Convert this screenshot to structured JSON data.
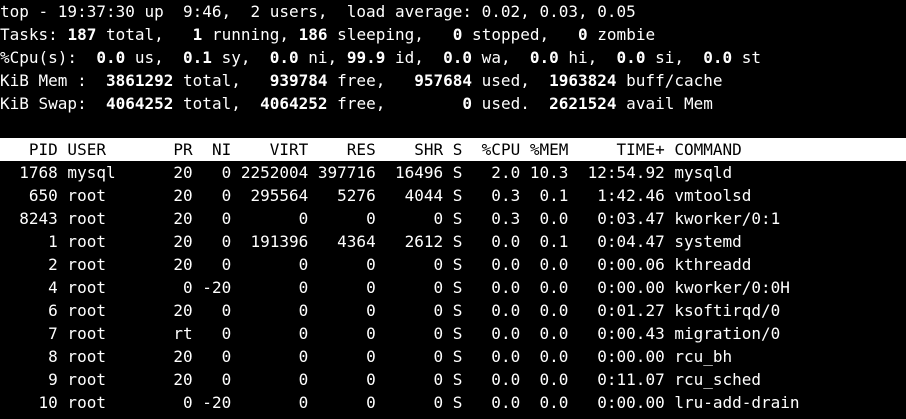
{
  "summary": {
    "l1": {
      "p0": "top - 19:37:30 up  9:46,  2 users,  load average: 0.02, 0.03, 0.05"
    },
    "l2": {
      "prefix": "Tasks: ",
      "total": "187",
      "total_label": " total,   ",
      "running": "1",
      "running_label": " running, ",
      "sleeping": "186",
      "sleeping_label": " sleeping,   ",
      "stopped": "0",
      "stopped_label": " stopped,   ",
      "zombie": "0",
      "zombie_label": " zombie"
    },
    "l3": {
      "prefix": "%Cpu(s):  ",
      "us": "0.0",
      "us_label": " us,  ",
      "sy": "0.1",
      "sy_label": " sy,  ",
      "ni": "0.0",
      "ni_label": " ni, ",
      "id": "99.9",
      "id_label": " id,  ",
      "wa": "0.0",
      "wa_label": " wa,  ",
      "hi": "0.0",
      "hi_label": " hi,  ",
      "si": "0.0",
      "si_label": " si,  ",
      "st": "0.0",
      "st_label": " st"
    },
    "l4": {
      "prefix": "KiB Mem :  ",
      "total": "3861292",
      "total_label": " total,   ",
      "free": "939784",
      "free_label": " free,   ",
      "used": "957684",
      "used_label": " used,  ",
      "cache": "1963824",
      "cache_label": " buff/cache"
    },
    "l5": {
      "prefix": "KiB Swap:  ",
      "total": "4064252",
      "total_label": " total,  ",
      "free": "4064252",
      "free_label": " free,        ",
      "used": "0",
      "used_label": " used.  ",
      "avail": "2621524",
      "avail_label": " avail Mem"
    }
  },
  "table": {
    "headers": {
      "pid": "PID",
      "user": "USER",
      "pr": "PR",
      "ni": "NI",
      "virt": "VIRT",
      "res": "RES",
      "shr": "SHR",
      "s": "S",
      "cpu": "%CPU",
      "mem": "%MEM",
      "time": "TIME+",
      "command": "COMMAND"
    },
    "rows": [
      {
        "pid": "1768",
        "user": "mysql",
        "pr": "20",
        "ni": "0",
        "virt": "2252004",
        "res": "397716",
        "shr": "16496",
        "s": "S",
        "cpu": "2.0",
        "mem": "10.3",
        "time": "12:54.92",
        "command": "mysqld"
      },
      {
        "pid": "650",
        "user": "root",
        "pr": "20",
        "ni": "0",
        "virt": "295564",
        "res": "5276",
        "shr": "4044",
        "s": "S",
        "cpu": "0.3",
        "mem": "0.1",
        "time": "1:42.46",
        "command": "vmtoolsd"
      },
      {
        "pid": "8243",
        "user": "root",
        "pr": "20",
        "ni": "0",
        "virt": "0",
        "res": "0",
        "shr": "0",
        "s": "S",
        "cpu": "0.3",
        "mem": "0.0",
        "time": "0:03.47",
        "command": "kworker/0:1"
      },
      {
        "pid": "1",
        "user": "root",
        "pr": "20",
        "ni": "0",
        "virt": "191396",
        "res": "4364",
        "shr": "2612",
        "s": "S",
        "cpu": "0.0",
        "mem": "0.1",
        "time": "0:04.47",
        "command": "systemd"
      },
      {
        "pid": "2",
        "user": "root",
        "pr": "20",
        "ni": "0",
        "virt": "0",
        "res": "0",
        "shr": "0",
        "s": "S",
        "cpu": "0.0",
        "mem": "0.0",
        "time": "0:00.06",
        "command": "kthreadd"
      },
      {
        "pid": "4",
        "user": "root",
        "pr": "0",
        "ni": "-20",
        "virt": "0",
        "res": "0",
        "shr": "0",
        "s": "S",
        "cpu": "0.0",
        "mem": "0.0",
        "time": "0:00.00",
        "command": "kworker/0:0H"
      },
      {
        "pid": "6",
        "user": "root",
        "pr": "20",
        "ni": "0",
        "virt": "0",
        "res": "0",
        "shr": "0",
        "s": "S",
        "cpu": "0.0",
        "mem": "0.0",
        "time": "0:01.27",
        "command": "ksoftirqd/0"
      },
      {
        "pid": "7",
        "user": "root",
        "pr": "rt",
        "ni": "0",
        "virt": "0",
        "res": "0",
        "shr": "0",
        "s": "S",
        "cpu": "0.0",
        "mem": "0.0",
        "time": "0:00.43",
        "command": "migration/0"
      },
      {
        "pid": "8",
        "user": "root",
        "pr": "20",
        "ni": "0",
        "virt": "0",
        "res": "0",
        "shr": "0",
        "s": "S",
        "cpu": "0.0",
        "mem": "0.0",
        "time": "0:00.00",
        "command": "rcu_bh"
      },
      {
        "pid": "9",
        "user": "root",
        "pr": "20",
        "ni": "0",
        "virt": "0",
        "res": "0",
        "shr": "0",
        "s": "S",
        "cpu": "0.0",
        "mem": "0.0",
        "time": "0:11.07",
        "command": "rcu_sched"
      },
      {
        "pid": "10",
        "user": "root",
        "pr": "0",
        "ni": "-20",
        "virt": "0",
        "res": "0",
        "shr": "0",
        "s": "S",
        "cpu": "0.0",
        "mem": "0.0",
        "time": "0:00.00",
        "command": "lru-add-drain"
      }
    ]
  },
  "colors": {
    "background": "#000000",
    "foreground": "#ffffff",
    "header_bar_bg": "#ffffff",
    "header_bar_fg": "#000000"
  }
}
